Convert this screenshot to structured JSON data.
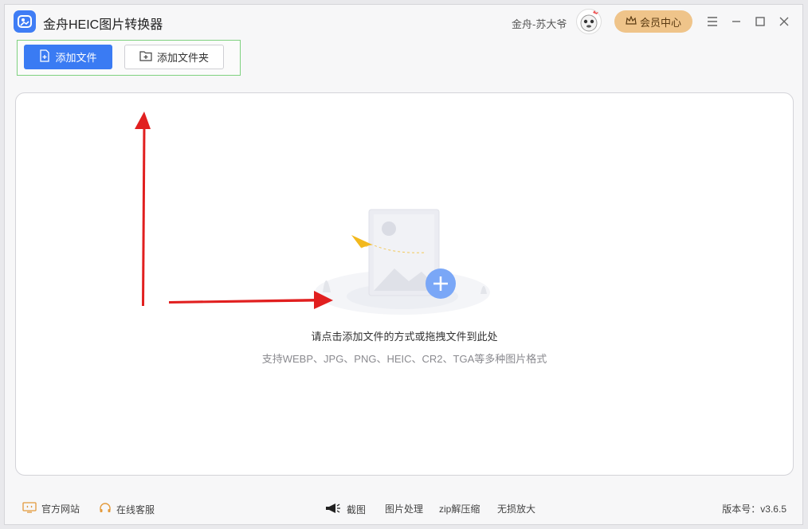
{
  "app": {
    "title": "金舟HEIC图片转换器",
    "brand_color": "#3a7bf3"
  },
  "header": {
    "user_name": "金舟-苏大爷",
    "vip_label": "会员中心"
  },
  "toolbar": {
    "add_file_label": "添加文件",
    "add_folder_label": "添加文件夹"
  },
  "dropzone": {
    "hint_main": "请点击添加文件的方式或拖拽文件到此处",
    "hint_sub": "支持WEBP、JPG、PNG、HEIC、CR2、TGA等多种图片格式"
  },
  "footer": {
    "website_label": "官方网站",
    "support_label": "在线客服",
    "tools": [
      "截图",
      "图片处理",
      "zip解压缩",
      "无损放大"
    ],
    "version": "版本号：v3.6.5"
  },
  "icons": [
    "app-logo-icon",
    "avatar",
    "crown-icon",
    "menu-icon",
    "minimize-icon",
    "maximize-icon",
    "close-icon",
    "file-add-icon",
    "folder-add-icon",
    "monitor-icon",
    "headset-icon",
    "megaphone-icon"
  ]
}
